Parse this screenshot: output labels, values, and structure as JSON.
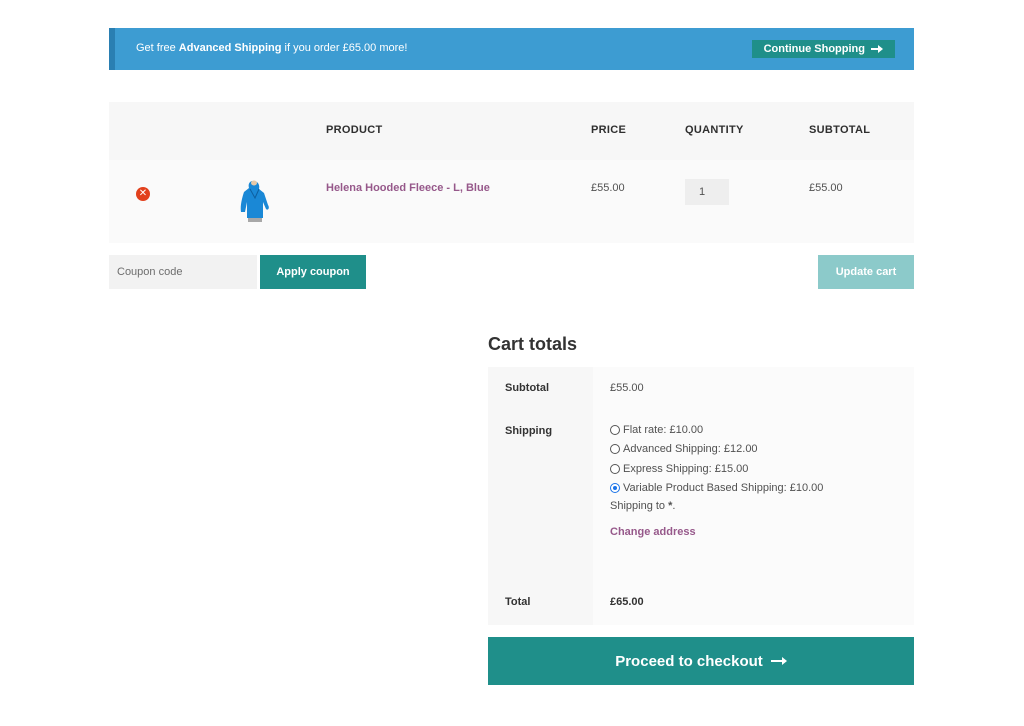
{
  "notice": {
    "prefix": "Get free ",
    "highlight": "Advanced Shipping",
    "suffix": " if you order £65.00 more!",
    "button_label": "Continue Shopping"
  },
  "cart": {
    "headers": {
      "product": "PRODUCT",
      "price": "PRICE",
      "quantity": "QUANTITY",
      "subtotal": "SUBTOTAL"
    },
    "items": [
      {
        "name": "Helena Hooded Fleece - L, Blue",
        "price": "£55.00",
        "quantity": "1",
        "subtotal": "£55.00",
        "remove_icon": "remove-icon",
        "thumbnail_icon": "hooded-fleece-thumbnail"
      }
    ]
  },
  "coupon": {
    "placeholder": "Coupon code",
    "apply_label": "Apply coupon",
    "update_label": "Update cart"
  },
  "totals": {
    "title": "Cart totals",
    "subtotal_label": "Subtotal",
    "subtotal_value": "£55.00",
    "shipping_label": "Shipping",
    "shipping_options": [
      {
        "label": "Flat rate: £10.00",
        "selected": false
      },
      {
        "label": "Advanced Shipping: £12.00",
        "selected": false
      },
      {
        "label": "Express Shipping: £15.00",
        "selected": false
      },
      {
        "label": "Variable Product Based Shipping: £10.00",
        "selected": true
      }
    ],
    "shipping_to_prefix": "Shipping to ",
    "shipping_to_value": "*",
    "shipping_to_suffix": ".",
    "change_address": "Change address",
    "total_label": "Total",
    "total_value": "£65.00"
  },
  "checkout": {
    "label": "Proceed to checkout"
  },
  "colors": {
    "notice_bg": "#3d9cd2",
    "accent": "#1f8f8a",
    "accent_muted": "#8ccaca",
    "link": "#96588a",
    "remove": "#e2401c"
  }
}
